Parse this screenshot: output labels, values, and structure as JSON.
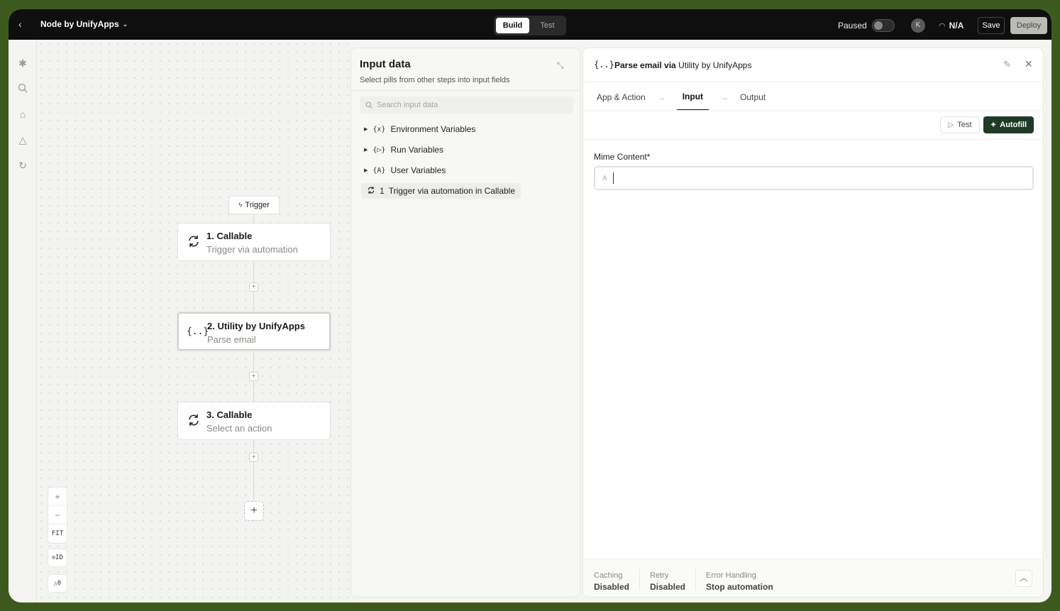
{
  "topbar": {
    "title": "Node by UnifyApps",
    "tabs": [
      "Build",
      "Test"
    ],
    "paused_label": "Paused",
    "avatar_initial": "K",
    "status": "N/A",
    "save_label": "Save",
    "deploy_label": "Deploy"
  },
  "canvas": {
    "trigger_label": "Trigger",
    "nodes": [
      {
        "title": "1. Callable",
        "subtitle": "Trigger via automation",
        "icon": "sync-icon"
      },
      {
        "title": "2. Utility by UnifyApps",
        "subtitle": "Parse email",
        "icon": "braces-icon"
      },
      {
        "title": "3. Callable",
        "subtitle": "Select an action",
        "icon": "sync-icon"
      }
    ],
    "zoom": {
      "fit_label": "FIT",
      "id_label": "ID",
      "warnings": "0"
    }
  },
  "input_panel": {
    "title": "Input data",
    "subtitle": "Select pills from other steps into input fields",
    "search_placeholder": "Search input data",
    "tree": [
      {
        "icon": "{x}",
        "label": "Environment Variables"
      },
      {
        "icon": "{▷}",
        "label": "Run Variables"
      },
      {
        "icon": "{A}",
        "label": "User Variables"
      }
    ],
    "step_pill": {
      "number": "1",
      "label": "Trigger via automation in Callable"
    }
  },
  "right_panel": {
    "title_bold": "Parse email via",
    "title_rest": "Utility by UnifyApps",
    "tabs": [
      "App & Action",
      "Input",
      "Output"
    ],
    "test_label": "Test",
    "autofill_label": "Autofill",
    "field_label": "Mime Content*",
    "footer": [
      {
        "label": "Caching",
        "value": "Disabled"
      },
      {
        "label": "Retry",
        "value": "Disabled"
      },
      {
        "label": "Error Handling",
        "value": "Stop automation"
      }
    ]
  },
  "colors": {
    "topbar_bg": "#0f0f0f",
    "accent_dark_green": "#1f3a26",
    "frame_border": "#3d5a1e"
  }
}
